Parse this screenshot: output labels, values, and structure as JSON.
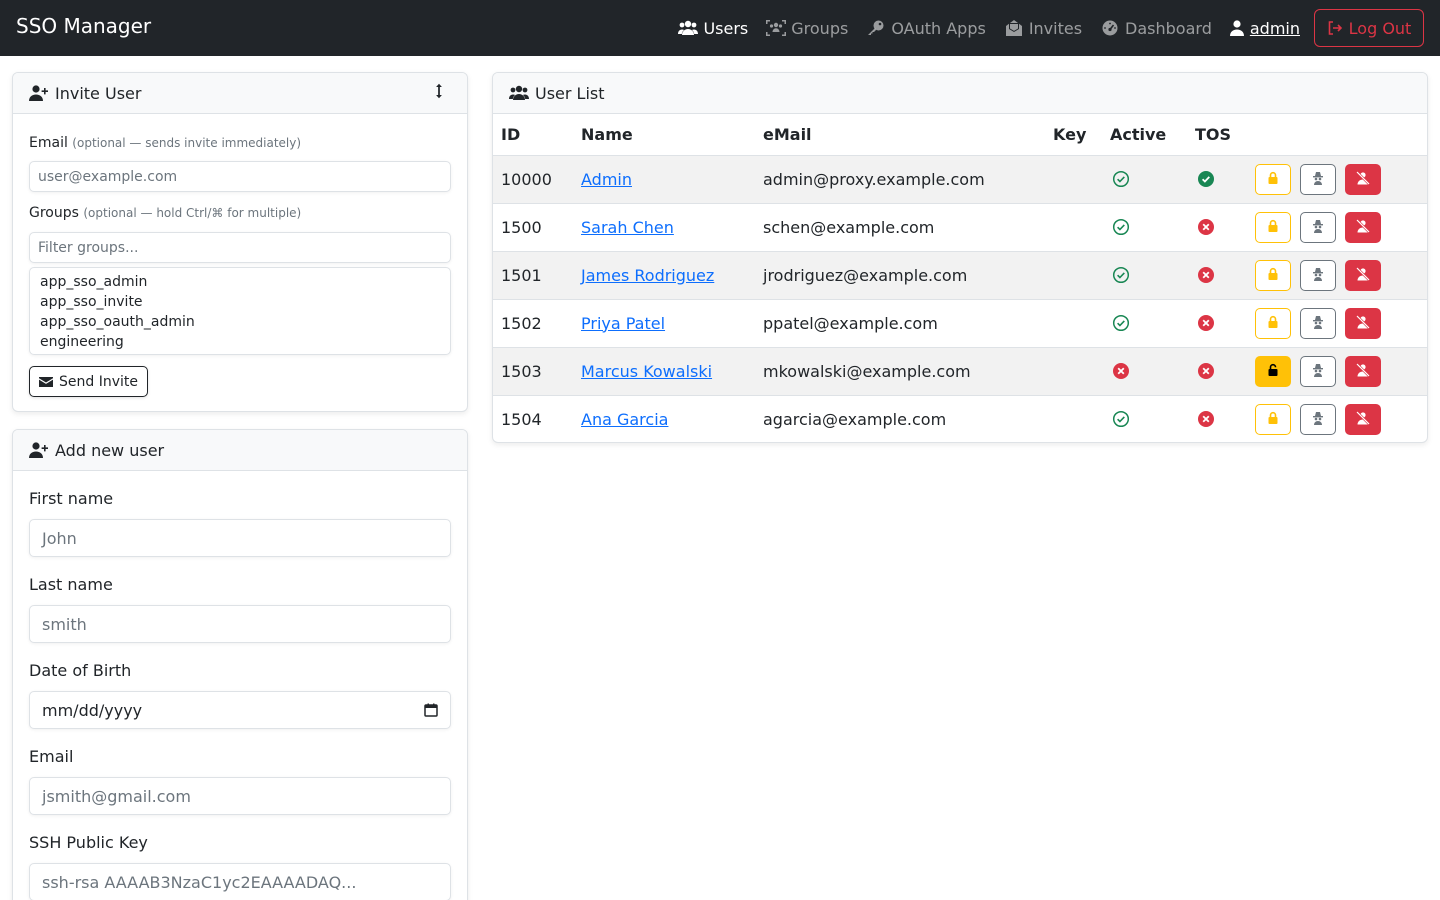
{
  "app": {
    "title": "SSO Manager"
  },
  "nav": {
    "items": [
      {
        "label": "Users",
        "icon": "users-icon",
        "active": true
      },
      {
        "label": "Groups",
        "icon": "groups-icon",
        "active": false
      },
      {
        "label": "OAuth Apps",
        "icon": "key-icon",
        "active": false
      },
      {
        "label": "Invites",
        "icon": "envelope-open-icon",
        "active": false
      },
      {
        "label": "Dashboard",
        "icon": "gauge-icon",
        "active": false
      }
    ],
    "user": "admin",
    "logout": "Log Out"
  },
  "invite": {
    "title": "Invite User",
    "email_label": "Email",
    "email_hint": "(optional — sends invite immediately)",
    "email_placeholder": "user@example.com",
    "groups_label": "Groups",
    "groups_hint": "(optional — hold Ctrl/⌘ for multiple)",
    "filter_placeholder": "Filter groups...",
    "group_options": [
      "app_sso_admin",
      "app_sso_invite",
      "app_sso_oauth_admin",
      "engineering"
    ],
    "send_button": "Send Invite"
  },
  "add_user": {
    "title": "Add new user",
    "first_name_label": "First name",
    "first_name_placeholder": "John",
    "last_name_label": "Last name",
    "last_name_placeholder": "smith",
    "dob_label": "Date of Birth",
    "dob_placeholder": "mm/dd/yyyy",
    "email_label": "Email",
    "email_placeholder": "jsmith@gmail.com",
    "ssh_label": "SSH Public Key",
    "ssh_placeholder": "ssh-rsa AAAAB3NzaC1yc2EAAAADAQ..."
  },
  "user_list": {
    "title": "User List",
    "columns": [
      "ID",
      "Name",
      "eMail",
      "Key",
      "Active",
      "TOS"
    ],
    "rows": [
      {
        "id": "10000",
        "name": "Admin",
        "email": "admin@proxy.example.com",
        "key": "",
        "active": true,
        "tos": true,
        "locked": false
      },
      {
        "id": "1500",
        "name": "Sarah Chen",
        "email": "schen@example.com",
        "key": "",
        "active": true,
        "tos": false,
        "locked": false
      },
      {
        "id": "1501",
        "name": "James Rodriguez",
        "email": "jrodriguez@example.com",
        "key": "",
        "active": true,
        "tos": false,
        "locked": false
      },
      {
        "id": "1502",
        "name": "Priya Patel",
        "email": "ppatel@example.com",
        "key": "",
        "active": true,
        "tos": false,
        "locked": false
      },
      {
        "id": "1503",
        "name": "Marcus Kowalski",
        "email": "mkowalski@example.com",
        "key": "",
        "active": false,
        "tos": false,
        "locked": true
      },
      {
        "id": "1504",
        "name": "Ana Garcia",
        "email": "agarcia@example.com",
        "key": "",
        "active": true,
        "tos": false,
        "locked": false
      }
    ]
  },
  "colors": {
    "navbar": "#212529",
    "link": "#0d6efd",
    "success": "#198754",
    "danger": "#dc3545",
    "warning": "#ffc107"
  }
}
